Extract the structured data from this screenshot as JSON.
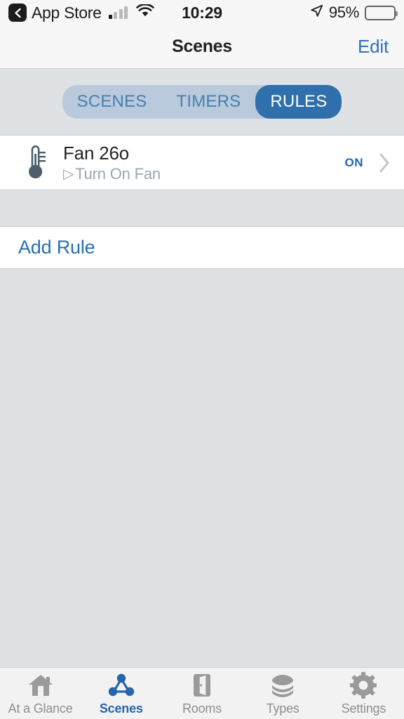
{
  "status_bar": {
    "back_app": "App Store",
    "back_icon": "chevron-left-icon",
    "signal_icon": "cellular-signal-icon",
    "wifi_icon": "wifi-icon",
    "time": "10:29",
    "location_icon": "location-arrow-icon",
    "battery_percent": "95%",
    "battery_icon": "battery-icon"
  },
  "nav": {
    "title": "Scenes",
    "edit_label": "Edit"
  },
  "segmented": {
    "options": [
      {
        "label": "SCENES",
        "active": false
      },
      {
        "label": "TIMERS",
        "active": false
      },
      {
        "label": "RULES",
        "active": true
      }
    ],
    "active_bg": "#2f6fab",
    "track_bg": "#b8cadb",
    "inactive_text": "#4a7fb0"
  },
  "rules": [
    {
      "icon": "thermometer-icon",
      "title": "Fan 26o",
      "action_glyph": "▷",
      "action": "Turn On Fan",
      "state": "ON",
      "chevron": "chevron-right-icon"
    }
  ],
  "add_rule": {
    "label": "Add Rule"
  },
  "tabs": [
    {
      "label": "At a Glance",
      "icon": "house-icon",
      "active": false
    },
    {
      "label": "Scenes",
      "icon": "nodes-icon",
      "active": true
    },
    {
      "label": "Rooms",
      "icon": "door-icon",
      "active": false
    },
    {
      "label": "Types",
      "icon": "layers-icon",
      "active": false
    },
    {
      "label": "Settings",
      "icon": "gear-icon",
      "active": false
    }
  ],
  "colors": {
    "accent_blue": "#2565ad",
    "link_blue": "#2a6db5",
    "page_bg": "#dde1e4",
    "icon_gray": "#9a9a9a",
    "thermometer": "#4d5f6b"
  }
}
